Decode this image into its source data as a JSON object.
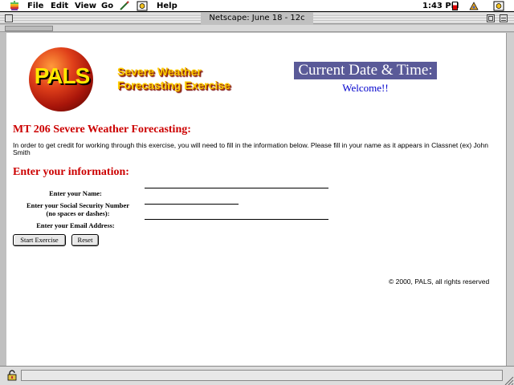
{
  "menubar": {
    "items": [
      "File",
      "Edit",
      "View",
      "Go",
      "Help"
    ],
    "clock": "1:43 PM"
  },
  "window": {
    "title": "Netscape: June 18 - 12c"
  },
  "page": {
    "logo_text": "PALS",
    "banner_line1": "Severe Weather",
    "banner_line2": "Forecasting Exercise",
    "datetime_label": "Current Date & Time:",
    "welcome": "Welcome!!",
    "heading": "MT 206 Severe Weather Forecasting:",
    "instructions": "In order to get credit for working through this exercise, you will need to fill in the information below. Please fill in your name as it appears in Classnet (ex) John Smith",
    "form_heading": "Enter your information:",
    "form": {
      "name_label": "Enter your Name:",
      "ssn_label_line1": "Enter your Social Security Number",
      "ssn_label_line2": "(no spaces or dashes):",
      "email_label": "Enter your Email Address:"
    },
    "buttons": {
      "start": "Start Exercise",
      "reset": "Reset"
    },
    "copyright": "© 2000, PALS, all rights reserved"
  }
}
